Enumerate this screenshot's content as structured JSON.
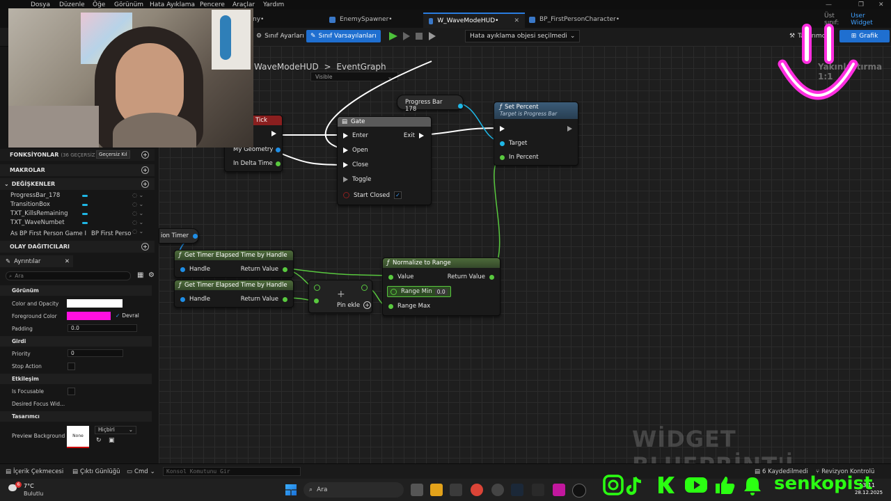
{
  "menu": [
    "Dosya",
    "Düzenle",
    "Öğe",
    "Görünüm",
    "Hata Ayıklama",
    "Pencere",
    "Araçlar",
    "Yardım"
  ],
  "tabs": [
    {
      "label": "ny•"
    },
    {
      "label": "EnemySpawner•"
    },
    {
      "label": "W_WaveModeHUD•"
    },
    {
      "label": "BP_FirstPersonCharacter•"
    }
  ],
  "parent_class": {
    "label": "Üst sınıf:",
    "value": "User Widget"
  },
  "toolbar": {
    "class_settings": "Sınıf Ayarları",
    "class_defaults": "Sınıf Varsayılanları",
    "debug_select": "Hata ayıklama objesi seçilmedi",
    "designer": "Tasarımcı",
    "graph": "Grafik"
  },
  "graph": {
    "breadcrumb_root": "WaveModeHUD",
    "breadcrumb_sep": ">",
    "breadcrumb_leaf": "EventGraph",
    "zoom": "Yakınlaştırma 1:1",
    "visible_dropdown": "Visible",
    "watermark": "WİDGET BLUEPRİNT'İ"
  },
  "nodes": {
    "tick": {
      "title": "Tick",
      "geometry": "My Geometry",
      "delta": "In Delta Time"
    },
    "gate": {
      "title": "Gate",
      "enter": "Enter",
      "exit": "Exit",
      "open": "Open",
      "close": "Close",
      "toggle": "Toggle",
      "start_closed": "Start Closed"
    },
    "progress_bar": {
      "title": "Progress Bar 178"
    },
    "set_percent": {
      "title": "Set Percent",
      "subtitle": "Target is Progress Bar",
      "target": "Target",
      "in_percent": "In Percent"
    },
    "timer_var": {
      "title": "ion Timer"
    },
    "get_timer_1": {
      "title": "Get Timer Elapsed Time by Handle",
      "handle": "Handle",
      "return": "Return Value"
    },
    "get_timer_2": {
      "title": "Get Timer Elapsed Time by Handle",
      "handle": "Handle",
      "return": "Return Value"
    },
    "add": {
      "symbol": "+",
      "add_pin": "Pin ekle"
    },
    "normalize": {
      "title": "Normalize to Range",
      "value": "Value",
      "return": "Return Value",
      "range_min": "Range Min",
      "range_min_val": "0.0",
      "range_max": "Range Max"
    }
  },
  "left_panel": {
    "functions": "FONKSİYONLAR",
    "functions_override": "(36 GEÇERSİZ KILIN",
    "override_btn": "Geçersiz Kıl",
    "macros": "MAKROLAR",
    "variables": "DEĞİŞKENLER",
    "vars": [
      "ProgressBar_178",
      "TransitionBox",
      "TXT_KillsRemaining",
      "TXT_WaveNumbet",
      "As BP First Person Game I"
    ],
    "var_type_last": "BP First Perso",
    "dispatchers": "OLAY DAĞITICILARI"
  },
  "details": {
    "tab": "Ayrıntılar",
    "search_placeholder": "Ara",
    "cat_appearance": "Görünüm",
    "color_opacity": "Color and Opacity",
    "foreground": "Foreground Color",
    "inherit": "Devral",
    "padding": "Padding",
    "padding_val": "0.0",
    "cat_input": "Girdi",
    "priority": "Priority",
    "priority_val": "0",
    "stop_action": "Stop Action",
    "cat_interaction": "Etkileşim",
    "is_focusable": "Is Focusable",
    "desired_focus": "Desired Focus Wid...",
    "cat_designer": "Tasarımcı",
    "preview_bg": "Preview Background",
    "none": "None",
    "hicbiri": "Hiçbiri",
    "colors": {
      "white": "#ffffff",
      "magenta": "#ff10e0"
    }
  },
  "status": {
    "content_drawer": "İçerik Çekmecesi",
    "output_log": "Çıktı Günlüğü",
    "cmd": "Cmd",
    "console_placeholder": "Konsol Komutunu Gir",
    "saved": "6 Kaydedilmedi",
    "revision": "Revizyon Kontrolü"
  },
  "taskbar": {
    "weather_temp": "7°C",
    "weather_desc": "Bulutlu",
    "weather_badge": "6",
    "search": "Ara",
    "time": "13:11",
    "date": "28.12.2025"
  },
  "overlay": {
    "brand": "senkopist"
  }
}
